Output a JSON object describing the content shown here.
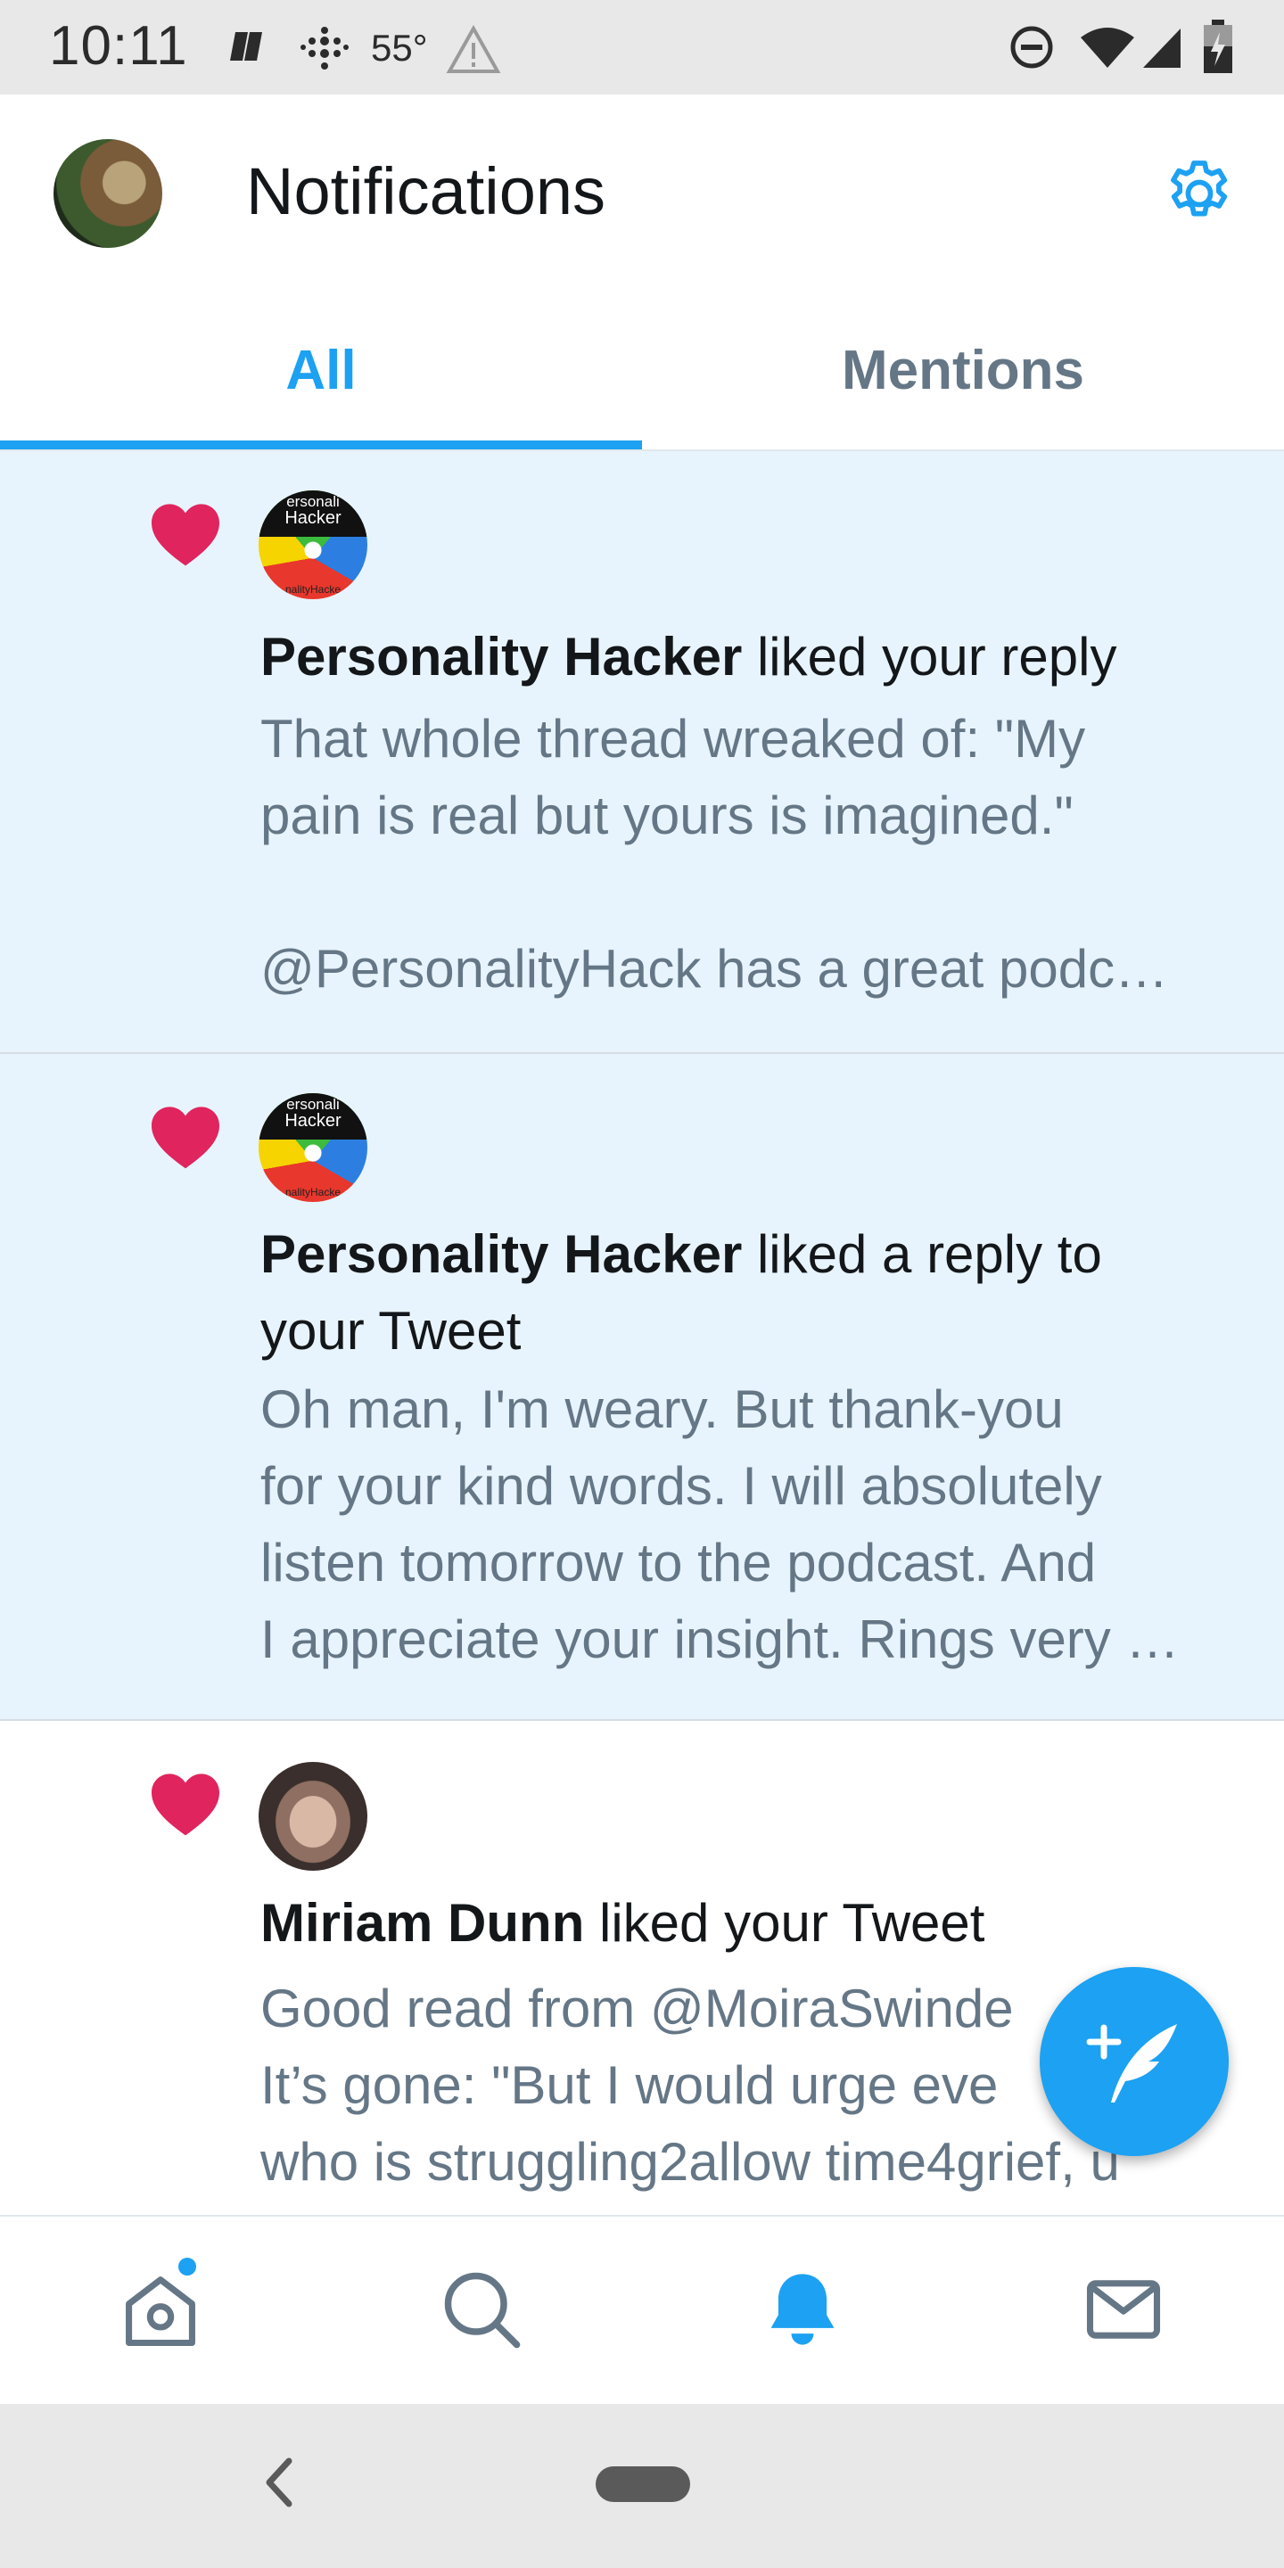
{
  "status_bar": {
    "time": "10:11",
    "temperature": "55°",
    "icons": [
      "notification-icon",
      "grid-dots-icon",
      "warning-icon",
      "dnd-icon",
      "wifi-icon",
      "signal-icon",
      "battery-icon"
    ]
  },
  "header": {
    "title": "Notifications",
    "settings_icon": "gear-icon"
  },
  "tabs": [
    {
      "label": "All",
      "active": true
    },
    {
      "label": "Mentions",
      "active": false
    }
  ],
  "colors": {
    "accent": "#1da1f2",
    "heart": "#e0245e",
    "unread_bg": "#e8f4fd",
    "secondary_text": "#657786"
  },
  "notifications": [
    {
      "icon": "heart-icon",
      "actor": "Personality Hacker",
      "action": "liked your reply",
      "avatar_text": [
        "ersonali",
        "Hacker",
        "nalityHacke"
      ],
      "body": [
        "That whole thread wreaked of: \"My",
        "pain is real but yours is imagined.\"",
        "",
        "@PersonalityHack has a great podc…"
      ],
      "unread": true
    },
    {
      "icon": "heart-icon",
      "actor": "Personality Hacker",
      "action_line1": "liked a reply to",
      "action_line2": "your Tweet",
      "avatar_text": [
        "ersonali",
        "Hacker",
        "nalityHacke"
      ],
      "body": [
        "Oh man, I'm weary. But thank-you",
        "for your kind words. I will absolutely",
        "listen tomorrow to the podcast. And",
        "I appreciate your insight. Rings very …"
      ],
      "unread": true
    },
    {
      "icon": "heart-icon",
      "actor": "Miriam Dunn",
      "action": "liked your Tweet",
      "body": [
        "Good read from @MoiraSwinde",
        "It’s gone: \"But I would urge eve",
        "who is struggling2allow time4grief, u"
      ],
      "unread": false
    }
  ],
  "fab": {
    "icon": "compose-tweet-icon"
  },
  "bottom_nav": [
    {
      "icon": "home-icon",
      "has_dot": true,
      "active": false
    },
    {
      "icon": "search-icon",
      "active": false
    },
    {
      "icon": "bell-icon",
      "active": true
    },
    {
      "icon": "mail-icon",
      "active": false
    }
  ],
  "system_nav": {
    "back_icon": "back-chevron-icon",
    "home_icon": "home-pill-icon"
  }
}
